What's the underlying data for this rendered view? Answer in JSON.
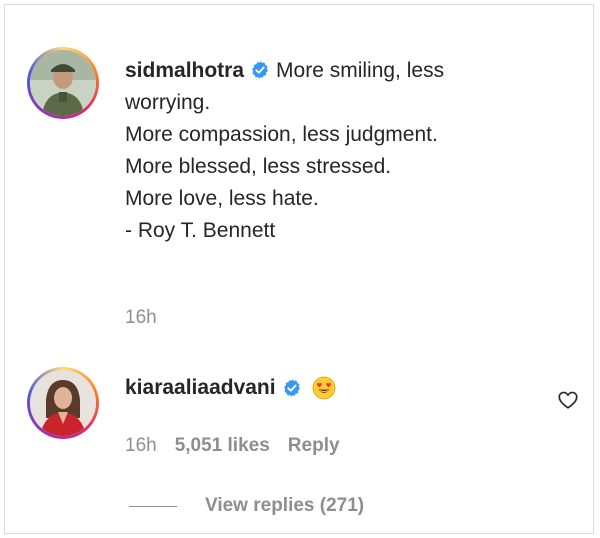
{
  "comment1": {
    "username": "sidmalhotra",
    "verified": true,
    "caption_lines": [
      "More smiling, less",
      "worrying.",
      "More compassion, less judgment.",
      "More blessed, less stressed.",
      "More love, less hate.",
      "",
      "- Roy T. Bennett"
    ],
    "time": "16h"
  },
  "comment2": {
    "username": "kiaraaliaadvani",
    "verified": true,
    "emoji": "smiling-face-with-heart-eyes",
    "time": "16h",
    "likes": "5,051 likes",
    "reply_label": "Reply",
    "view_replies_label": "View replies (271)"
  },
  "colors": {
    "text": "#262626",
    "muted": "#8e8e8e",
    "verified_blue": "#3897f0",
    "story_ring": [
      "#feda75",
      "#fa7e1e",
      "#d62976",
      "#962fbf",
      "#4f5bd5"
    ]
  },
  "icons": {
    "verified": "verified-badge-icon",
    "like": "heart-outline-icon"
  }
}
